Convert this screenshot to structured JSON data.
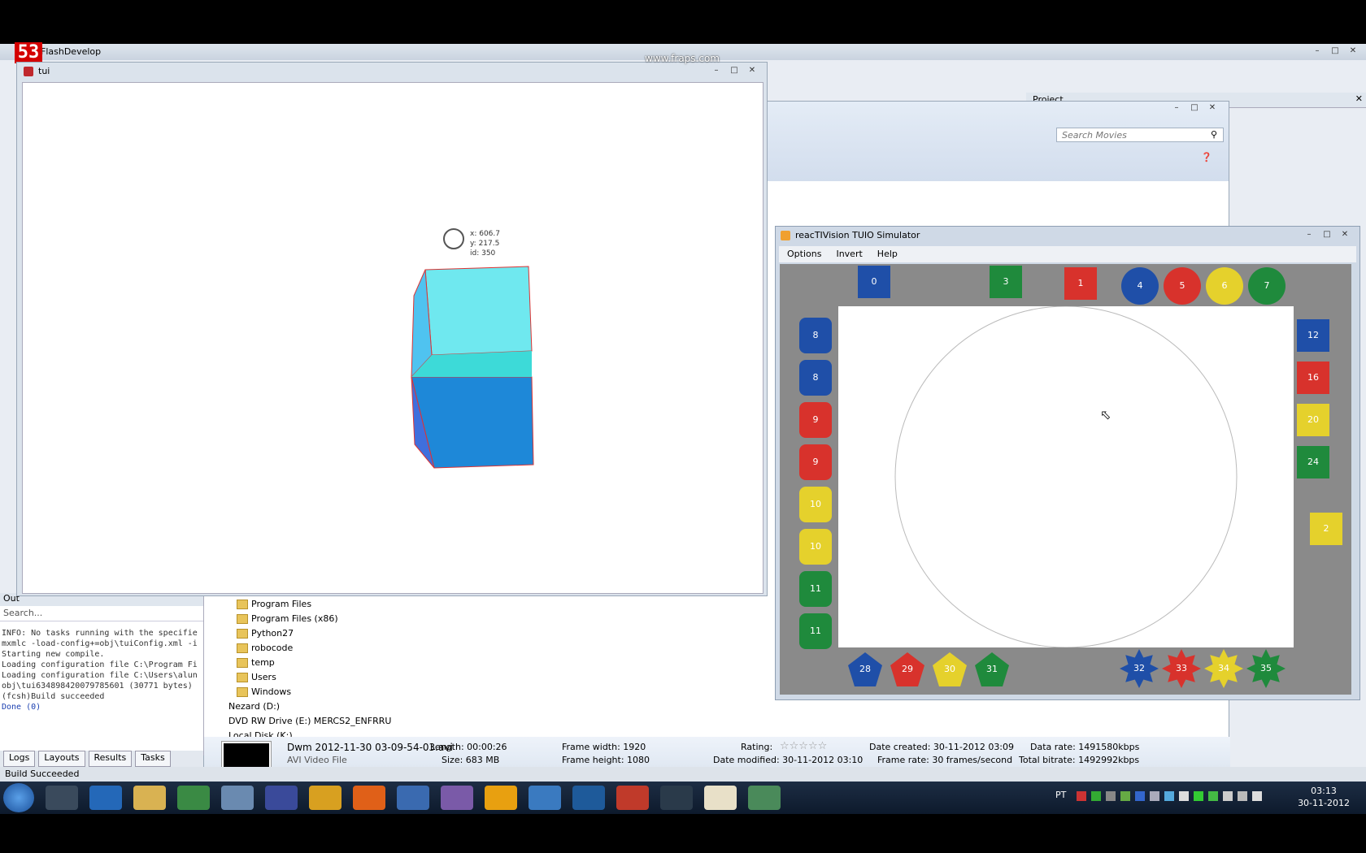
{
  "ide": {
    "title": "FlashDevelop",
    "fraps_counter": "53",
    "watermark": "www.fraps.com"
  },
  "tui": {
    "title": "tui",
    "cursor_x": "x: 606.7",
    "cursor_y": "y: 217.5",
    "cursor_id": "id: 350"
  },
  "output": {
    "tab_label": "Out",
    "search_placeholder": "Search...",
    "lines": [
      "INFO: No tasks running with the specifie",
      "mxmlc -load-config+=obj\\tuiConfig.xml -i",
      "Starting new compile.",
      "Loading configuration file C:\\Program Fi",
      "Loading configuration file C:\\Users\\alun",
      "obj\\tui634898420079785601 (30771 bytes)",
      "(fcsh)Build succeeded"
    ],
    "done": "Done (0)"
  },
  "bottom_tabs": [
    "Logs",
    "Layouts",
    "Results",
    "Tasks"
  ],
  "status_bar": "Build Succeeded",
  "project_panel": "Project",
  "explorer": {
    "search_placeholder": "Search Movies",
    "tree": [
      "Program Files",
      "Program Files (x86)",
      "Python27",
      "robocode",
      "temp",
      "Users",
      "Windows"
    ],
    "drives": [
      "Nezard (D:)",
      "DVD RW Drive (E:) MERCS2_ENFRRU",
      "Local Disk (K:)"
    ],
    "details": {
      "filename": "Dwm 2012-11-30 03-09-54-03.avi",
      "filetype": "AVI Video File",
      "length": "Length: 00:00:26",
      "size": "Size: 683 MB",
      "frame_width": "Frame width: 1920",
      "frame_height": "Frame height: 1080",
      "rating": "Rating:",
      "date_modified": "Date modified: 30-11-2012 03:10",
      "date_created": "Date created: 30-11-2012 03:09",
      "frame_rate": "Frame rate: 30 frames/second",
      "data_rate": "Data rate: 1491580kbps",
      "total_bitrate": "Total bitrate: 1492992kbps"
    }
  },
  "reac": {
    "title": "reacTIVision TUIO Simulator",
    "menu": [
      "Options",
      "Invert",
      "Help"
    ],
    "top": [
      "0",
      "3",
      "1",
      "4",
      "5",
      "6",
      "7"
    ],
    "left": [
      "8",
      "8",
      "9",
      "9",
      "10",
      "10",
      "11",
      "11"
    ],
    "right": [
      "12",
      "16",
      "20",
      "24",
      "2"
    ],
    "bottom": [
      "28",
      "29",
      "30",
      "31",
      "32",
      "33",
      "34",
      "35"
    ]
  },
  "taskbar": {
    "lang": "PT",
    "time": "03:13",
    "date": "30-11-2012"
  },
  "colors": {
    "blue": "#1f4fa8",
    "red": "#d8322c",
    "yellow": "#e5d12c",
    "green": "#1f8a3c",
    "cube_top": "#6fe8ef",
    "cube_front": "#1e88d8"
  }
}
